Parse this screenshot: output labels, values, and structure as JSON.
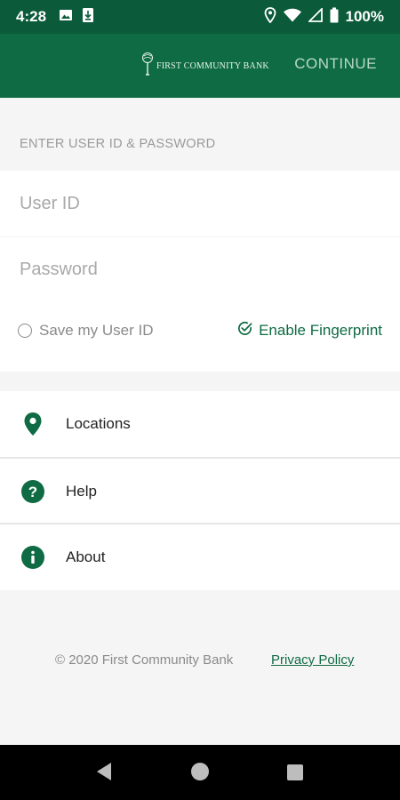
{
  "status_bar": {
    "time": "4:28",
    "battery": "100%",
    "icons": [
      "image-icon",
      "download-icon",
      "location-icon",
      "wifi-icon",
      "signal-icon",
      "battery-icon"
    ]
  },
  "app_bar": {
    "logo_text": "FIRST COMMUNITY BANK",
    "continue_label": "CONTINUE",
    "brand_color": "#0e6b43"
  },
  "login": {
    "section_title": "ENTER USER ID & PASSWORD",
    "user_id_placeholder": "User ID",
    "user_id_value": "",
    "password_placeholder": "Password",
    "password_value": "",
    "save_user_id_label": "Save my User ID",
    "save_user_id_checked": false,
    "enable_fingerprint_label": "Enable Fingerprint",
    "enable_fingerprint_checked": true
  },
  "menu": {
    "items": [
      {
        "label": "Locations",
        "icon": "location-pin-icon"
      },
      {
        "label": "Help",
        "icon": "help-icon"
      },
      {
        "label": "About",
        "icon": "info-icon"
      }
    ]
  },
  "footer": {
    "copyright": "© 2020 First Community Bank",
    "privacy_label": "Privacy Policy"
  }
}
